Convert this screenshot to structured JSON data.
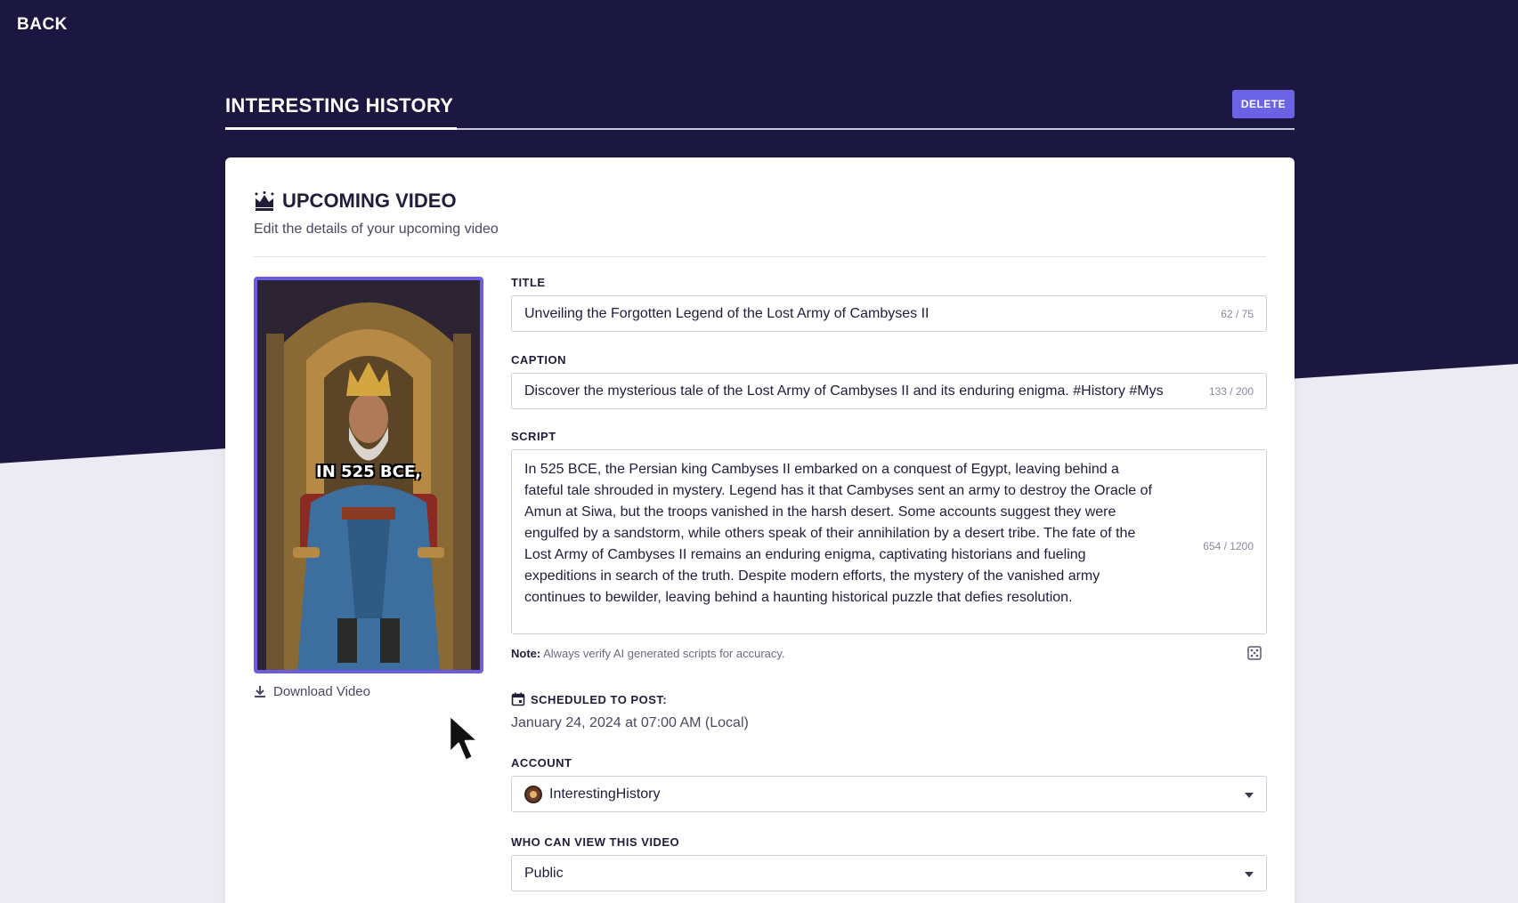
{
  "nav": {
    "back_label": "BACK"
  },
  "header": {
    "title": "INTERESTING HISTORY",
    "delete_label": "DELETE"
  },
  "card": {
    "title": "UPCOMING VIDEO",
    "subtitle": "Edit the details of your upcoming video"
  },
  "thumbnail": {
    "caption": "IN 525 BCE,"
  },
  "download": {
    "label": "Download Video"
  },
  "form": {
    "title": {
      "label": "TITLE",
      "value": "Unveiling the Forgotten Legend of the Lost Army of Cambyses II",
      "counter": "62 / 75"
    },
    "caption": {
      "label": "CAPTION",
      "value": "Discover the mysterious tale of the Lost Army of Cambyses II and its enduring enigma. #History #Mys",
      "counter": "133 / 200"
    },
    "script": {
      "label": "SCRIPT",
      "lines": [
        "In 525 BCE, the Persian king Cambyses II embarked on a conquest of Egypt, leaving behind a",
        "fateful tale shrouded in mystery. Legend has it that Cambyses sent an army to destroy the Oracle of",
        "Amun at Siwa, but the troops vanished in the harsh desert. Some accounts suggest they were",
        "engulfed by a sandstorm, while others speak of their annihilation by a desert tribe. The fate of the",
        "Lost Army of Cambyses II remains an enduring enigma, captivating historians and fueling",
        "expeditions in search of the truth. Despite modern efforts, the mystery of the vanished army",
        "continues to bewilder, leaving behind a haunting historical puzzle that defies resolution."
      ],
      "counter": "654 / 1200"
    },
    "note": {
      "prefix": "Note:",
      "text": " Always verify AI generated scripts for accuracy."
    },
    "schedule": {
      "label": "SCHEDULED TO POST:",
      "value": "January 24, 2024 at 07:00 AM (Local)"
    },
    "account": {
      "label": "ACCOUNT",
      "value": "InterestingHistory"
    },
    "visibility": {
      "label": "WHO CAN VIEW THIS VIDEO",
      "value": "Public"
    }
  },
  "icons": {
    "card_title": "crown-icon",
    "download": "download-icon",
    "schedule": "calendar-icon",
    "note_action": "dice-icon",
    "select_caret": "chevron-down-icon"
  },
  "colors": {
    "dark_background": "#1b1740",
    "light_background": "#ecebf3",
    "accent": "#6b63e6",
    "thumbnail_border": "#6c5ce0"
  }
}
